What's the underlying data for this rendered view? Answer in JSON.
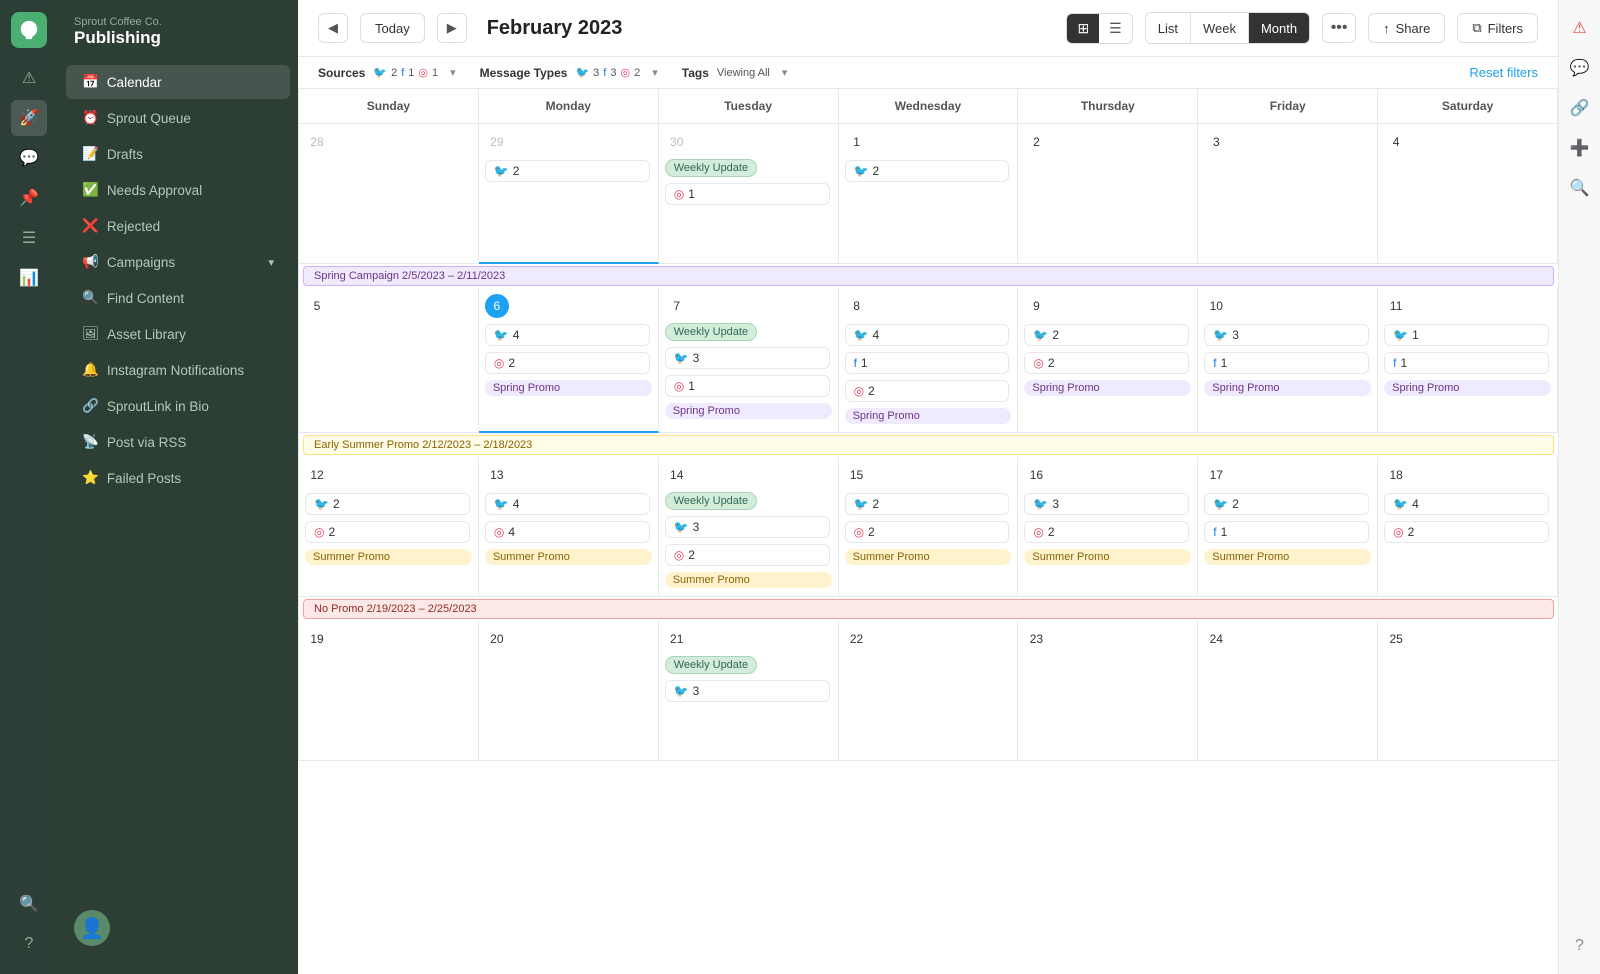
{
  "brand": {
    "company": "Sprout Coffee Co.",
    "app": "Publishing"
  },
  "nav": {
    "items": [
      {
        "id": "calendar",
        "label": "Calendar",
        "active": true
      },
      {
        "id": "sprout-queue",
        "label": "Sprout Queue",
        "active": false
      },
      {
        "id": "drafts",
        "label": "Drafts",
        "active": false
      },
      {
        "id": "needs-approval",
        "label": "Needs Approval",
        "active": false
      },
      {
        "id": "rejected",
        "label": "Rejected",
        "active": false
      },
      {
        "id": "campaigns",
        "label": "Campaigns",
        "active": false,
        "hasChevron": true
      },
      {
        "id": "find-content",
        "label": "Find Content",
        "active": false
      },
      {
        "id": "asset-library",
        "label": "Asset Library",
        "active": false
      },
      {
        "id": "instagram-notifications",
        "label": "Instagram Notifications",
        "active": false
      },
      {
        "id": "sproutlink",
        "label": "SproutLink in Bio",
        "active": false
      },
      {
        "id": "post-via-rss",
        "label": "Post via RSS",
        "active": false
      },
      {
        "id": "failed-posts",
        "label": "Failed Posts",
        "active": false
      }
    ]
  },
  "topbar": {
    "today_label": "Today",
    "month_title": "February 2023",
    "view_list": "List",
    "view_week": "Week",
    "view_month": "Month",
    "more": "•••",
    "share": "Share",
    "filters": "Filters"
  },
  "filters": {
    "sources_label": "Sources",
    "sources": {
      "twitter": 2,
      "facebook": 1,
      "instagram": 1
    },
    "message_types_label": "Message Types",
    "message_types": {
      "twitter": 3,
      "facebook": 3,
      "instagram": 2
    },
    "tags_label": "Tags",
    "tags_value": "Viewing All",
    "reset": "Reset filters"
  },
  "calendar": {
    "days": [
      "Sunday",
      "Monday",
      "Tuesday",
      "Wednesday",
      "Thursday",
      "Friday",
      "Saturday"
    ],
    "weeks": [
      {
        "campaign": null,
        "cells": [
          {
            "num": "28",
            "other": true,
            "today": false,
            "posts": []
          },
          {
            "num": "29",
            "other": true,
            "today": false,
            "posts": [
              {
                "type": "twitter",
                "count": 2
              }
            ]
          },
          {
            "num": "30",
            "other": true,
            "today": false,
            "weeklyUpdate": true,
            "posts": [
              {
                "type": "instagram",
                "count": 1
              }
            ]
          },
          {
            "num": "1",
            "other": false,
            "today": false,
            "posts": [
              {
                "type": "twitter",
                "count": 2
              }
            ]
          },
          {
            "num": "2",
            "other": false,
            "today": false,
            "posts": []
          },
          {
            "num": "3",
            "other": false,
            "today": false,
            "posts": []
          },
          {
            "num": "4",
            "other": false,
            "today": false,
            "posts": []
          }
        ]
      },
      {
        "campaign": {
          "label": "Spring Campaign 2/5/2023 – 2/11/2023",
          "type": "spring"
        },
        "cells": [
          {
            "num": "5",
            "other": false,
            "today": false,
            "posts": []
          },
          {
            "num": "6",
            "other": false,
            "today": true,
            "posts": [
              {
                "type": "twitter",
                "count": 4
              },
              {
                "type": "instagram",
                "count": 2
              },
              {
                "promo": "Spring Promo"
              }
            ]
          },
          {
            "num": "7",
            "other": false,
            "today": false,
            "weeklyUpdate": true,
            "posts": [
              {
                "type": "twitter",
                "count": 3
              },
              {
                "type": "instagram",
                "count": 1
              },
              {
                "promo": "Spring Promo"
              }
            ]
          },
          {
            "num": "8",
            "other": false,
            "today": false,
            "posts": [
              {
                "type": "twitter",
                "count": 4
              },
              {
                "type": "facebook",
                "count": 1
              },
              {
                "type": "instagram",
                "count": 2
              },
              {
                "promo": "Spring Promo"
              }
            ]
          },
          {
            "num": "9",
            "other": false,
            "today": false,
            "posts": [
              {
                "type": "twitter",
                "count": 2
              },
              {
                "type": "instagram",
                "count": 2
              },
              {
                "promo": "Spring Promo"
              }
            ]
          },
          {
            "num": "10",
            "other": false,
            "today": false,
            "posts": [
              {
                "type": "twitter",
                "count": 3
              },
              {
                "type": "facebook",
                "count": 1
              },
              {
                "promo": "Spring Promo"
              }
            ]
          },
          {
            "num": "11",
            "other": false,
            "today": false,
            "posts": [
              {
                "type": "twitter",
                "count": 1
              },
              {
                "type": "facebook",
                "count": 1
              },
              {
                "promo": "Spring Promo"
              }
            ]
          }
        ]
      },
      {
        "campaign": {
          "label": "Early Summer Promo 2/12/2023 – 2/18/2023",
          "type": "summer"
        },
        "cells": [
          {
            "num": "12",
            "other": false,
            "today": false,
            "posts": [
              {
                "type": "twitter",
                "count": 2
              },
              {
                "type": "instagram",
                "count": 2
              },
              {
                "promo": "Summer Promo"
              }
            ]
          },
          {
            "num": "13",
            "other": false,
            "today": false,
            "posts": [
              {
                "type": "twitter",
                "count": 4
              },
              {
                "type": "instagram",
                "count": 4
              },
              {
                "promo": "Summer Promo"
              }
            ]
          },
          {
            "num": "14",
            "other": false,
            "today": false,
            "weeklyUpdate": true,
            "posts": [
              {
                "type": "twitter",
                "count": 3
              },
              {
                "type": "instagram",
                "count": 2
              },
              {
                "promo": "Summer Promo"
              }
            ]
          },
          {
            "num": "15",
            "other": false,
            "today": false,
            "posts": [
              {
                "type": "twitter",
                "count": 2
              },
              {
                "type": "instagram",
                "count": 2
              },
              {
                "promo": "Summer Promo"
              }
            ]
          },
          {
            "num": "16",
            "other": false,
            "today": false,
            "posts": [
              {
                "type": "twitter",
                "count": 3
              },
              {
                "type": "instagram",
                "count": 2
              },
              {
                "promo": "Summer Promo"
              }
            ]
          },
          {
            "num": "17",
            "other": false,
            "today": false,
            "posts": [
              {
                "type": "twitter",
                "count": 2
              },
              {
                "type": "facebook",
                "count": 1
              },
              {
                "promo": "Summer Promo"
              }
            ]
          },
          {
            "num": "18",
            "other": false,
            "today": false,
            "posts": [
              {
                "type": "twitter",
                "count": 4
              },
              {
                "type": "instagram",
                "count": 2
              }
            ]
          }
        ]
      },
      {
        "campaign": {
          "label": "No Promo 2/19/2023 – 2/25/2023",
          "type": "nopromo"
        },
        "cells": [
          {
            "num": "19",
            "other": false,
            "today": false,
            "posts": []
          },
          {
            "num": "20",
            "other": false,
            "today": false,
            "posts": []
          },
          {
            "num": "21",
            "other": false,
            "today": false,
            "weeklyUpdate": true,
            "posts": [
              {
                "type": "twitter",
                "count": 3
              }
            ]
          },
          {
            "num": "22",
            "other": false,
            "today": false,
            "posts": []
          },
          {
            "num": "23",
            "other": false,
            "today": false,
            "posts": []
          },
          {
            "num": "24",
            "other": false,
            "today": false,
            "posts": []
          },
          {
            "num": "25",
            "other": false,
            "today": false,
            "posts": []
          }
        ]
      }
    ]
  },
  "weekly_update_label": "Weekly Update",
  "spring_promo_label": "Spring Promo",
  "summer_promo_label": "Summer Promo"
}
